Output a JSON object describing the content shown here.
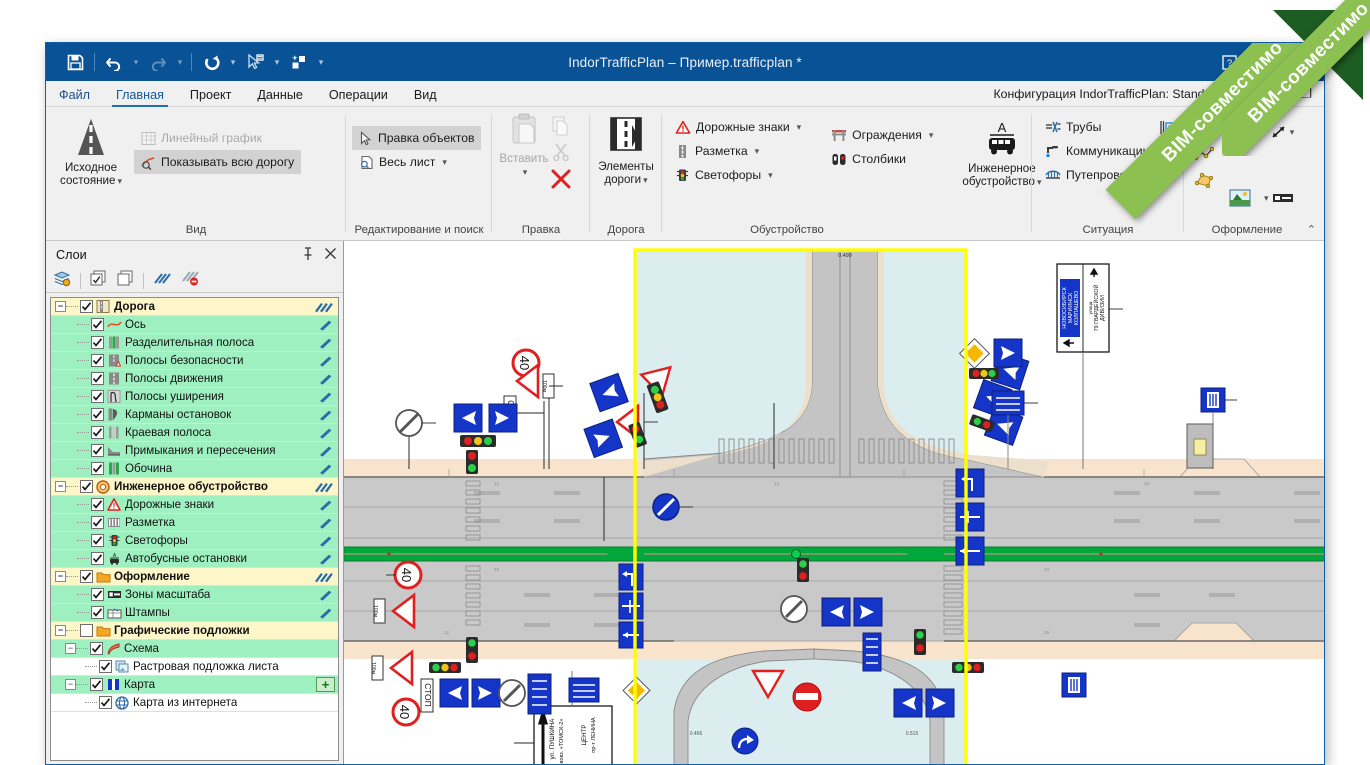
{
  "window": {
    "title": "IndorTrafficPlan – Пример.trafficplan *",
    "quick_access": [
      {
        "name": "save-icon",
        "label": "Сохранить"
      },
      {
        "name": "undo-icon",
        "label": "Отменить"
      },
      {
        "name": "redo-icon",
        "label": "Вернуть"
      },
      {
        "name": "rotate-icon",
        "label": "Поворот"
      },
      {
        "name": "cursor-select-icon",
        "label": "Выбор"
      },
      {
        "name": "objects-icon",
        "label": "Объекты"
      }
    ],
    "caption_buttons": [
      {
        "name": "help-icon",
        "glyph": "?"
      },
      {
        "name": "restore-icon",
        "glyph": "[ ]"
      },
      {
        "name": "minimize-icon",
        "glyph": "—"
      }
    ],
    "badge": "BIM-совместимо"
  },
  "tabs": [
    {
      "id": "file",
      "label": "Файл",
      "active": false
    },
    {
      "id": "home",
      "label": "Главная",
      "active": true
    },
    {
      "id": "project",
      "label": "Проект",
      "active": false
    },
    {
      "id": "data",
      "label": "Данные",
      "active": false
    },
    {
      "id": "operations",
      "label": "Операции",
      "active": false
    },
    {
      "id": "view",
      "label": "Вид",
      "active": false
    }
  ],
  "config": {
    "label": "Конфигурация IndorTrafficPlan: Standard",
    "warning_glyph": "!",
    "minimize": "—",
    "restore": "❐"
  },
  "ribbon": {
    "groups": [
      {
        "id": "view",
        "label": "Вид",
        "big": [
          {
            "name": "source-state-button",
            "label": "Исходное\nсостояние",
            "icon": "road-icon",
            "caret": true
          }
        ],
        "small": [
          {
            "name": "linear-graph-button",
            "label": "Линейный график",
            "icon": "table-icon",
            "disabled": true,
            "selected": false,
            "caret": false
          },
          {
            "name": "show-whole-road-button",
            "label": "Показывать всю дорогу",
            "icon": "zoom-road-icon",
            "disabled": false,
            "selected": true,
            "caret": false
          }
        ]
      },
      {
        "id": "editing",
        "label": "Редактирование и поиск",
        "small": [
          {
            "name": "edit-objects-button",
            "label": "Правка объектов",
            "icon": "arrow-cursor-icon",
            "selected": true,
            "caret": false
          },
          {
            "name": "whole-sheet-button",
            "label": "Весь лист",
            "icon": "page-zoom-icon",
            "selected": false,
            "caret": true
          }
        ]
      },
      {
        "id": "clipboard",
        "label": "Правка",
        "big": [
          {
            "name": "paste-button",
            "label": "Вставить",
            "icon": "clipboard-icon",
            "disabled": true,
            "caret": true
          }
        ],
        "stack": [
          {
            "name": "copy-button",
            "icon": "copy-icon",
            "disabled": true
          },
          {
            "name": "cut-button",
            "icon": "scissors-icon",
            "disabled": true
          },
          {
            "name": "delete-button",
            "icon": "red-cross-icon",
            "disabled": false
          }
        ]
      },
      {
        "id": "road",
        "label": "Дорога",
        "big": [
          {
            "name": "road-elements-button",
            "label": "Элементы\nдороги",
            "icon": "road-lanes-icon",
            "caret": true
          }
        ]
      },
      {
        "id": "equipment",
        "label": "Обустройство",
        "small": [
          {
            "name": "road-signs-button",
            "label": "Дорожные знаки",
            "icon": "warning-triangle-icon",
            "caret": true
          },
          {
            "name": "markings-button",
            "label": "Разметка",
            "icon": "marking-icon",
            "caret": true
          },
          {
            "name": "traffic-lights-button",
            "label": "Светофоры",
            "icon": "traffic-light-icon",
            "caret": true
          }
        ],
        "small2": [
          {
            "name": "barriers-button",
            "label": "Ограждения",
            "icon": "barrier-icon",
            "caret": true
          },
          {
            "name": "bollards-button",
            "label": "Столбики",
            "icon": "bollard-icon",
            "caret": false
          }
        ],
        "big": [
          {
            "name": "engineering-equipment-button",
            "label": "Инженерное\nобустройство",
            "icon": "bus-icon",
            "caret": true
          }
        ]
      },
      {
        "id": "situation",
        "label": "Ситуация",
        "small": [
          {
            "name": "pipes-button",
            "label": "Трубы",
            "icon": "pipe-icon",
            "caret": false
          },
          {
            "name": "communications-button",
            "label": "Коммуникации",
            "icon": "tap-icon",
            "caret": false
          },
          {
            "name": "overpass-button",
            "label": "Путепровод",
            "icon": "bridge-icon",
            "caret": true
          }
        ],
        "icons": [
          {
            "name": "structure-icon"
          },
          {
            "name": "building-icon"
          },
          {
            "name": "railway-icon"
          }
        ]
      },
      {
        "id": "design",
        "label": "Оформление",
        "icons": [
          {
            "name": "point-icon"
          },
          {
            "name": "text-aa-icon",
            "label": "Aa"
          },
          {
            "name": "dimension-arrow-icon",
            "caret": true
          },
          {
            "name": "polyline-icon"
          },
          {
            "name": "polygon-icon"
          },
          {
            "name": "image-icon",
            "caret": true
          },
          {
            "name": "scale-bar-icon"
          }
        ],
        "collapse": {
          "name": "collapse-ribbon-icon",
          "glyph": "⌃"
        }
      }
    ]
  },
  "layers_panel": {
    "title": "Слои",
    "pin_icon": "pin-icon",
    "close_icon": "close-icon",
    "toolbar": [
      {
        "name": "layer-properties-icon"
      },
      {
        "name": "check-all-layers-icon"
      },
      {
        "name": "uncheck-all-layers-icon"
      },
      {
        "name": "enable-edit-all-icon"
      },
      {
        "name": "disable-edit-all-icon"
      }
    ],
    "tree": [
      {
        "level": 0,
        "type": "group",
        "label": "Дорога",
        "icon": "road-layer-icon",
        "checked": true,
        "expanded": true,
        "pen": "triple"
      },
      {
        "level": 1,
        "type": "leaf",
        "label": "Ось",
        "icon": "axis-curve-icon",
        "checked": true,
        "pen": "single"
      },
      {
        "level": 1,
        "type": "leaf",
        "label": "Разделительная полоса",
        "icon": "median-strip-icon",
        "checked": true,
        "pen": "single"
      },
      {
        "level": 1,
        "type": "leaf",
        "label": "Полосы безопасности",
        "icon": "safety-lane-icon",
        "checked": true,
        "pen": "single"
      },
      {
        "level": 1,
        "type": "leaf",
        "label": "Полосы движения",
        "icon": "traffic-lane-icon",
        "checked": true,
        "pen": "single"
      },
      {
        "level": 1,
        "type": "leaf",
        "label": "Полосы уширения",
        "icon": "widening-lane-icon",
        "checked": true,
        "pen": "single"
      },
      {
        "level": 1,
        "type": "leaf",
        "label": "Карманы остановок",
        "icon": "stop-pocket-icon",
        "checked": true,
        "pen": "single"
      },
      {
        "level": 1,
        "type": "leaf",
        "label": "Краевая полоса",
        "icon": "edge-lane-icon",
        "checked": true,
        "pen": "single"
      },
      {
        "level": 1,
        "type": "leaf",
        "label": "Примыкания и пересечения",
        "icon": "junction-icon",
        "checked": true,
        "pen": "single"
      },
      {
        "level": 1,
        "type": "leaf",
        "label": "Обочина",
        "icon": "shoulder-icon",
        "checked": true,
        "pen": "single"
      },
      {
        "level": 0,
        "type": "group",
        "label": "Инженерное обустройство",
        "icon": "equipment-layer-icon",
        "checked": true,
        "expanded": true,
        "pen": "triple"
      },
      {
        "level": 1,
        "type": "leaf",
        "label": "Дорожные знаки",
        "icon": "warning-triangle-icon",
        "checked": true,
        "pen": "single"
      },
      {
        "level": 1,
        "type": "leaf",
        "label": "Разметка",
        "icon": "marking-icon",
        "checked": true,
        "pen": "single"
      },
      {
        "level": 1,
        "type": "leaf",
        "label": "Светофоры",
        "icon": "traffic-light-icon",
        "checked": true,
        "pen": "single"
      },
      {
        "level": 1,
        "type": "leaf",
        "label": "Автобусные остановки",
        "icon": "bus-stop-icon",
        "checked": true,
        "pen": "single"
      },
      {
        "level": 0,
        "type": "group",
        "label": "Оформление",
        "icon": "folder-icon",
        "checked": true,
        "expanded": true,
        "pen": "triple"
      },
      {
        "level": 1,
        "type": "leaf",
        "label": "Зоны масштаба",
        "icon": "scale-zone-icon",
        "checked": true,
        "pen": "single"
      },
      {
        "level": 1,
        "type": "leaf",
        "label": "Штампы",
        "icon": "stamp-icon",
        "checked": true,
        "pen": "single"
      },
      {
        "level": 0,
        "type": "group",
        "label": "Графические подложки",
        "icon": "folder-icon",
        "checked": false,
        "expanded": true,
        "pen": "none"
      },
      {
        "level": 1,
        "type": "leaf",
        "label": "Схема",
        "icon": "scheme-icon",
        "checked": true,
        "expanded": true,
        "pen": "none"
      },
      {
        "level": 2,
        "type": "plain",
        "label": "Растровая подложка листа",
        "icon": "raster-icon",
        "checked": true,
        "pen": "none"
      },
      {
        "level": 1,
        "type": "leaf",
        "label": "Карта",
        "icon": "map-icon",
        "checked": true,
        "expanded": true,
        "plus": "+"
      },
      {
        "level": 2,
        "type": "plain",
        "label": "Карта из интернета",
        "icon": "globe-icon",
        "checked": true,
        "pen": "none"
      }
    ]
  },
  "canvas": {
    "selection_frame_color": "#ffff00",
    "selection_fill_color": "#daeef0",
    "road_surface_color": "#c8c8c8",
    "shoulder_color": "#f7e2c8",
    "median_color": "#00a03c",
    "signs": {
      "speed_limit": "40",
      "stop": "СТОП",
      "distance_plate": "100м",
      "direction_sign_left_lines": [
        "НОВОСИБИРСК",
        "МАРИИНСК",
        "КОЛПАШЕВО"
      ],
      "direction_sign_right_lines": [
        "улица",
        "79 ГВАРДЕЙСКОЙ",
        "ДИВИЗИИ"
      ],
      "bottom_sign_left_lines": [
        "ул. ПУШКИНА",
        "вокз. «ТОМСК-2»"
      ],
      "bottom_sign_right_lines": [
        "ЦЕНТР",
        "пр-т ЛЕНИНА"
      ]
    },
    "dimension_labels": [
      "0.499",
      "0.466",
      "0.515"
    ]
  }
}
